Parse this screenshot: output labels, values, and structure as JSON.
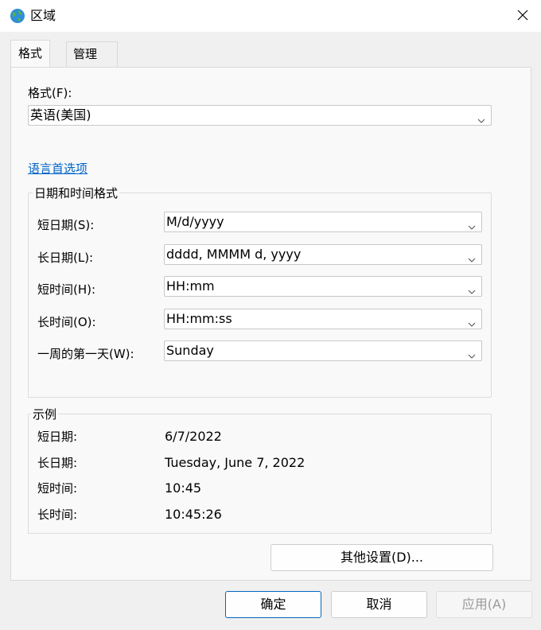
{
  "window": {
    "title": "区域"
  },
  "tabs": [
    {
      "label": "格式"
    },
    {
      "label": "管理"
    }
  ],
  "format": {
    "label": "格式(F):",
    "value": "英语(美国)"
  },
  "language_link": "语言首选项",
  "datetime_group": {
    "title": "日期和时间格式",
    "rows": [
      {
        "label": "短日期(S):",
        "value": "M/d/yyyy"
      },
      {
        "label": "长日期(L):",
        "value": "dddd, MMMM d, yyyy"
      },
      {
        "label": "短时间(H):",
        "value": "HH:mm"
      },
      {
        "label": "长时间(O):",
        "value": "HH:mm:ss"
      },
      {
        "label": "一周的第一天(W):",
        "value": "Sunday"
      }
    ]
  },
  "example_group": {
    "title": "示例",
    "rows": [
      {
        "label": "短日期:",
        "value": "6/7/2022"
      },
      {
        "label": "长日期:",
        "value": "Tuesday, June 7, 2022"
      },
      {
        "label": "短时间:",
        "value": "10:45"
      },
      {
        "label": "长时间:",
        "value": "10:45:26"
      }
    ]
  },
  "buttons": {
    "additional_settings": "其他设置(D)...",
    "ok": "确定",
    "cancel": "取消",
    "apply": "应用(A)"
  },
  "icons": {
    "app": "globe-icon",
    "close": "close-icon",
    "dropdown": "chevron-down-icon"
  },
  "colors": {
    "link": "#0064c8",
    "primary_border": "#0067c0",
    "disabled_text": "#9a9a9a"
  }
}
